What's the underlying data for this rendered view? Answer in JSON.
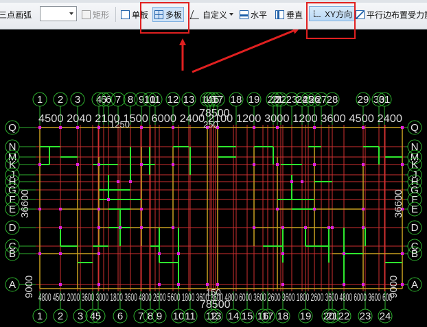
{
  "toolbar": {
    "three_point_arc": "三点画弧",
    "rect_label": "矩形",
    "single_label": "单板",
    "multi_label": "多板",
    "custom_label": "自定义",
    "horizontal_label": "水平",
    "vertical_label": "垂直",
    "xy_label": "XY方向",
    "parallel_label": "平行边布置受力筋"
  },
  "drawing": {
    "top_axis_labels": [
      "1",
      "2",
      "3",
      "4",
      "5",
      "6",
      "7",
      "8",
      "9",
      "10",
      "11",
      "12",
      "13",
      "14",
      "15",
      "16",
      "17",
      "18",
      "19",
      "20",
      "21",
      "22",
      "23",
      "24",
      "25",
      "26",
      "27",
      "28",
      "29",
      "30",
      "31"
    ],
    "bottom_axis_labels": [
      "1",
      "2",
      "3",
      "4",
      "5",
      "6",
      "7",
      "8",
      "9",
      "10",
      "11",
      "12",
      "13",
      "14",
      "15",
      "16",
      "17",
      "18",
      "19",
      "20",
      "21",
      "22",
      "23",
      "24"
    ],
    "left_axis_labels": [
      "Q",
      "N",
      "M",
      "K",
      "J",
      "H",
      "G",
      "F",
      "E",
      "D",
      "C",
      "B",
      "A"
    ],
    "right_axis_labels": [
      "Q",
      "N",
      "M",
      "K",
      "J",
      "H",
      "G",
      "F",
      "E",
      "D",
      "C",
      "B",
      "A"
    ],
    "top_dimension_text": "4500 2040 2100 1500 6000 2400 2100 1200 3000 1200 3600 4500 2400",
    "top_total_dimension": "78500",
    "top_sub_dimension_1": "1250",
    "top_sub_dimension_2": "250",
    "bottom_dimension_text": "4800 4500 2000 3600 3000 1800 3600 4800 2600 5600 1800 3600 3600 4800 6000 3600 2600 3600 1800 2600 3600 4800 6000 3600 600",
    "bottom_total_dimension": "78500",
    "bottom_sub_dimension": "150",
    "left_vertical_dimension": "36600",
    "right_vertical_dimension": "36600",
    "left_bottom_dim": "9000",
    "right_bottom_dim": "9000",
    "colors": {
      "axis_line": "#d03030",
      "axis_circle": "#2fb52f",
      "beam": "#2ee82e",
      "wall": "#c8a020",
      "column": "#e020e0",
      "dimension_text": "#d8d8d8"
    }
  }
}
